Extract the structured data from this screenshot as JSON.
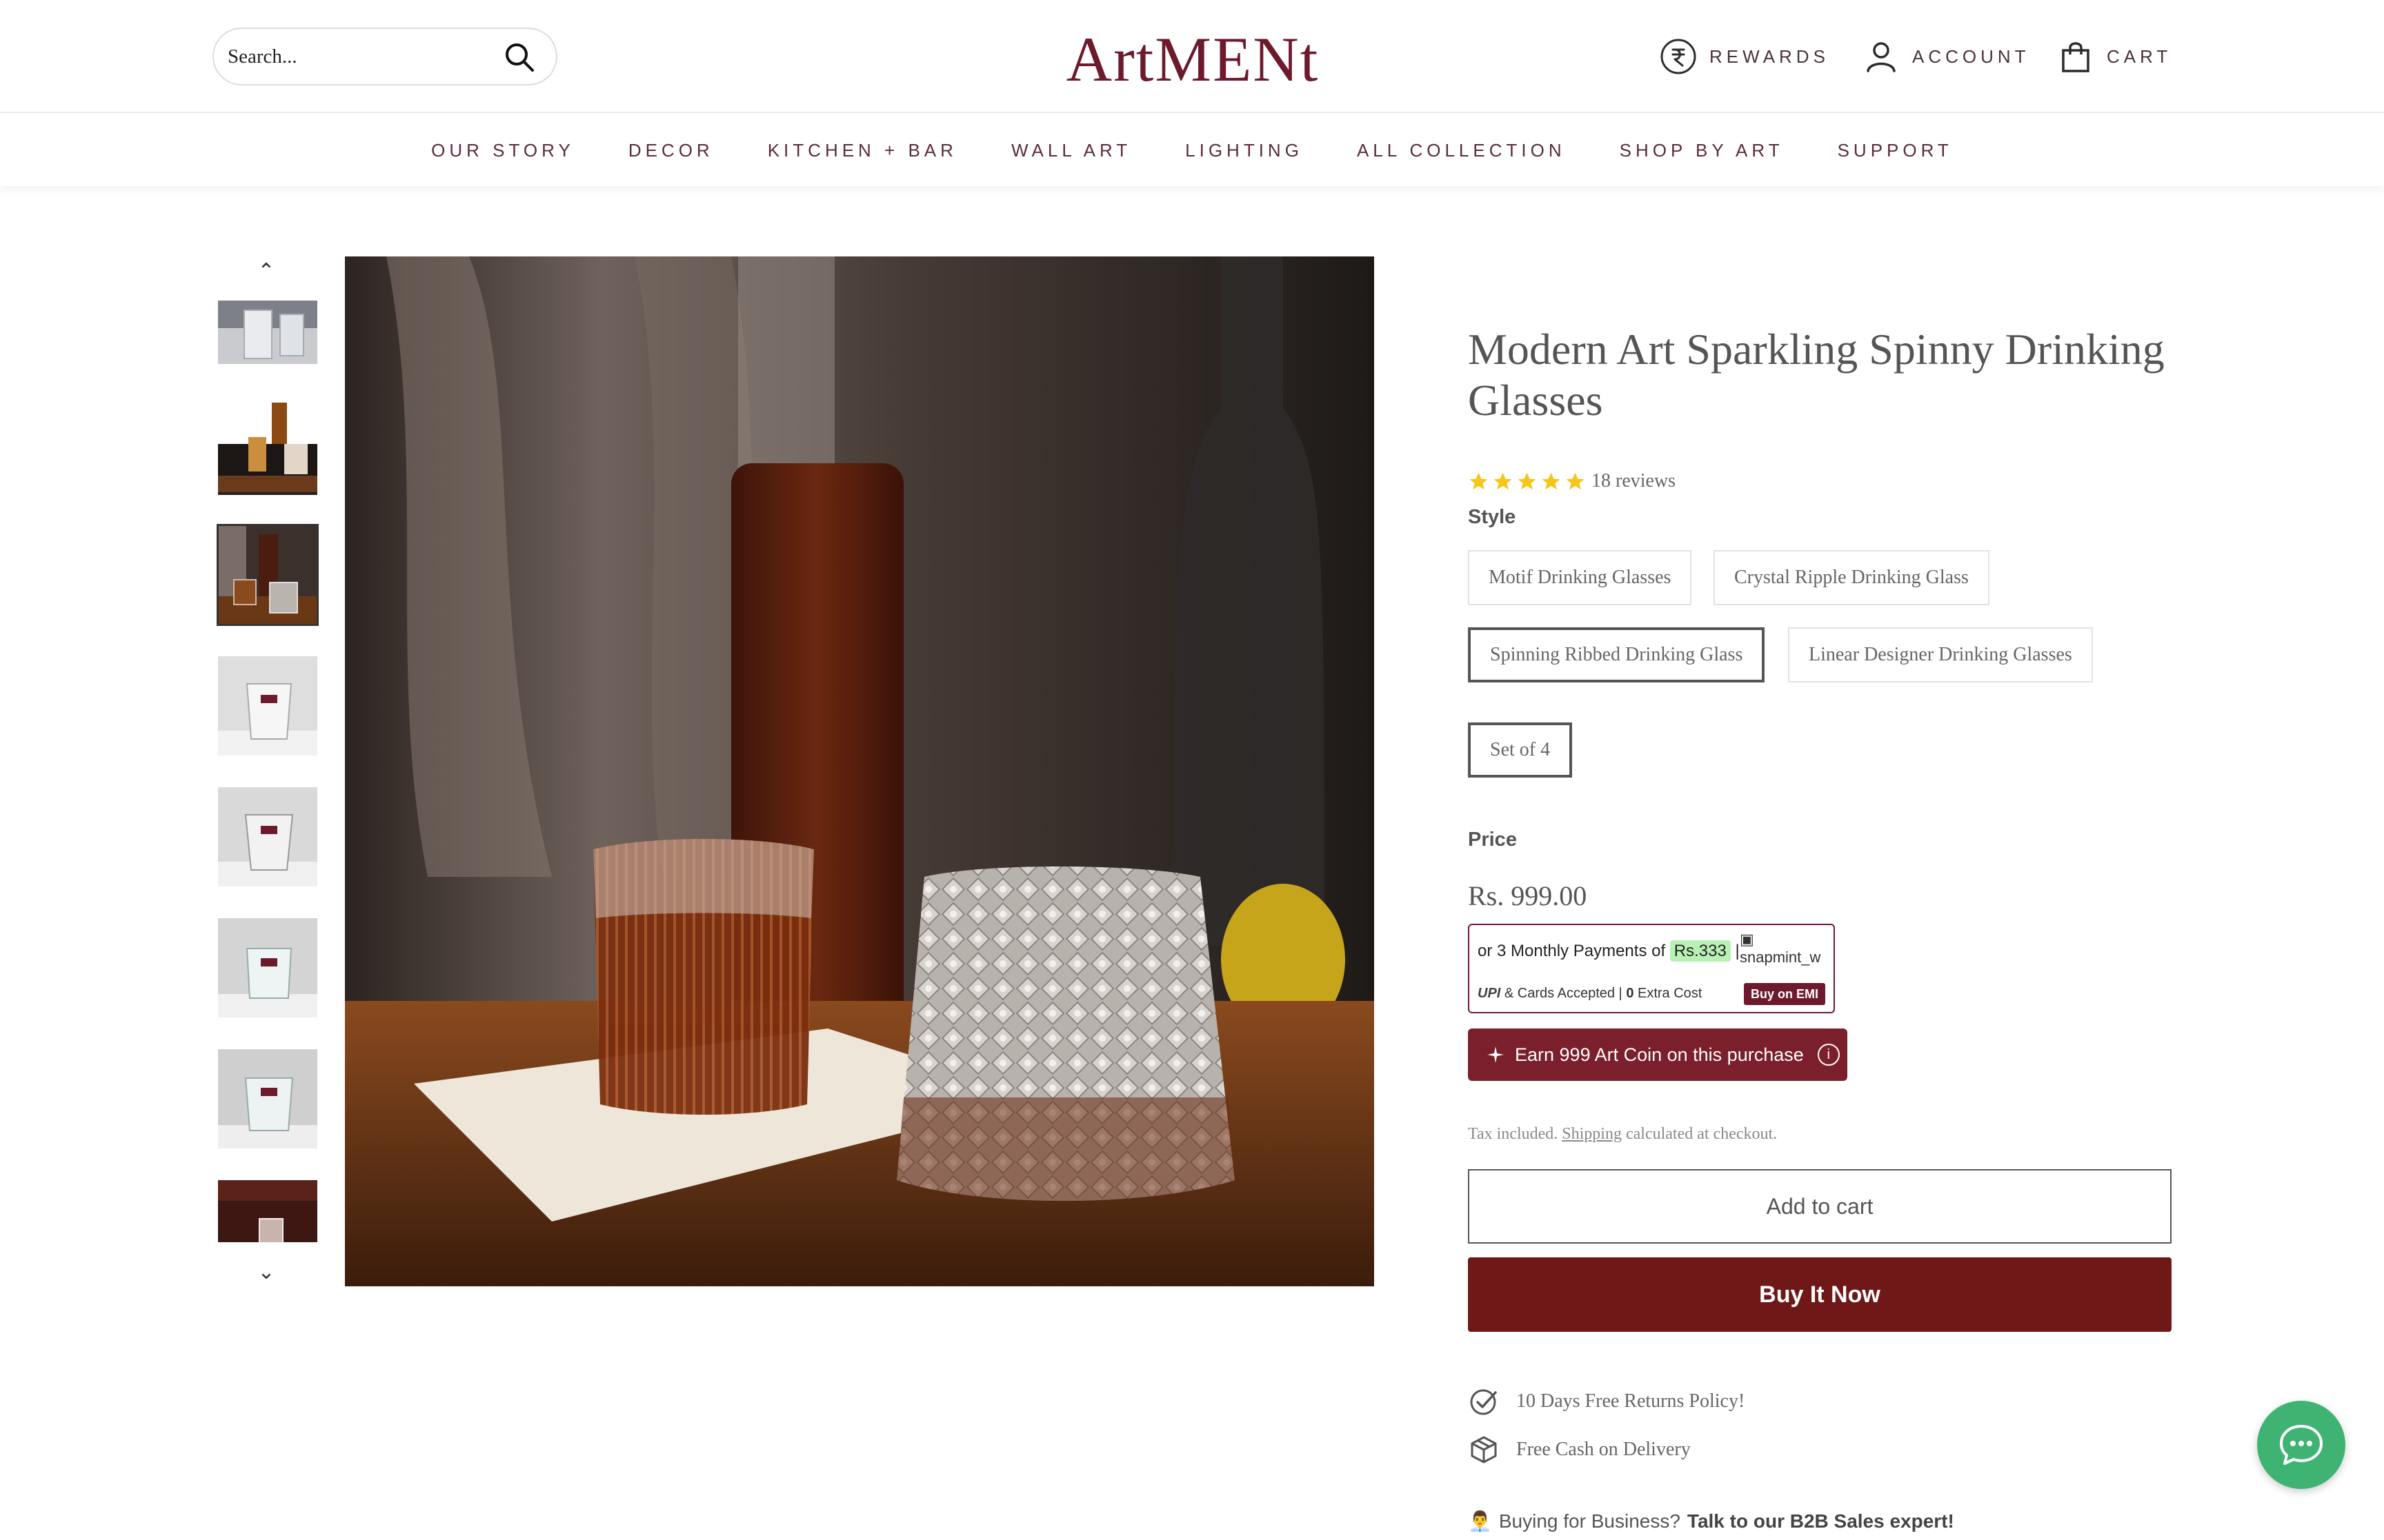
{
  "header": {
    "search_placeholder": "Search...",
    "logo": "ArtMENt",
    "rewards": "REWARDS",
    "account": "ACCOUNT",
    "cart": "CART"
  },
  "nav": {
    "items": [
      "OUR STORY",
      "DECOR",
      "KITCHEN + BAR",
      "WALL ART",
      "LIGHTING",
      "ALL COLLECTION",
      "SHOP BY ART",
      "SUPPORT"
    ]
  },
  "gallery": {
    "thumbnail_count_visible": 8,
    "selected_index": 2
  },
  "product": {
    "title": "Modern Art Sparkling Spinny Drinking Glasses",
    "rating": 5,
    "reviews": "18 reviews",
    "style_label": "Style",
    "styles": [
      "Motif Drinking Glasses",
      "Crystal Ripple Drinking Glass",
      "Spinning Ribbed Drinking Glass",
      "Linear Designer Drinking Glasses"
    ],
    "selected_style": "Spinning Ribbed Drinking Glass",
    "pack": "Set of 4",
    "price_label": "Price",
    "price": "Rs. 999.00",
    "emi": {
      "prefix": "or 3 Monthly Payments of",
      "amount": "Rs.333",
      "separator": "|",
      "snap_alt": "snapmint_w",
      "upi": "UPI",
      "cards": "& Cards Accepted |",
      "extra_zero": "0",
      "extra_cost": "Extra Cost",
      "buy_on_emi": "Buy on EMI"
    },
    "coin_text": "Earn 999 Art Coin on this purchase",
    "tax_prefix": "Tax included.",
    "tax_link": "Shipping",
    "tax_suffix": "calculated at checkout.",
    "add_to_cart": "Add to cart",
    "buy_now": "Buy It Now",
    "perks": [
      "10 Days Free Returns Policy!",
      "Free Cash on Delivery"
    ],
    "b2b_prefix": "Buying for Business?",
    "b2b_cta": "Talk to our B2B Sales expert!"
  },
  "colors": {
    "brand": "#6d1a2d",
    "buy_button": "#701717",
    "coin_bg": "#7a1f2b",
    "chat": "#3fb372",
    "star": "#f5c518"
  }
}
